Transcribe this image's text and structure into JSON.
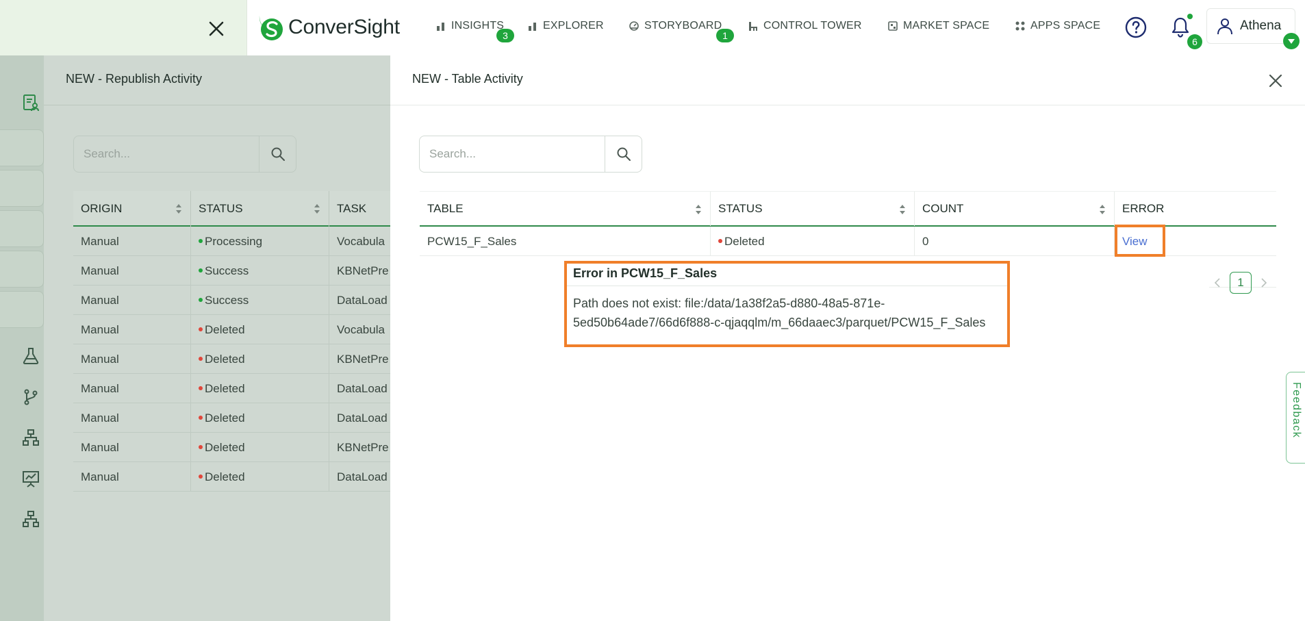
{
  "app": {
    "logo_text": "ConverSight",
    "brand_color": "#1fa53c"
  },
  "nav": {
    "items": [
      {
        "label": "INSIGHTS",
        "icon": "bar-chart-icon",
        "badge": "3"
      },
      {
        "label": "EXPLORER",
        "icon": "bar-chart-icon",
        "badge": ""
      },
      {
        "label": "STORYBOARD",
        "icon": "dashboard-gauge-icon",
        "badge": "1"
      },
      {
        "label": "CONTROL TOWER",
        "icon": "control-tower-icon",
        "badge": ""
      },
      {
        "label": "MARKET SPACE",
        "icon": "market-space-icon",
        "badge": ""
      },
      {
        "label": "APPS SPACE",
        "icon": "apps-grid-icon",
        "badge": ""
      }
    ],
    "notifications_count": "6",
    "user_name": "Athena"
  },
  "republish_panel": {
    "title": "NEW - Republish Activity",
    "search_placeholder": "Search...",
    "columns": [
      "ORIGIN",
      "STATUS",
      "TASK"
    ],
    "rows": [
      {
        "origin": "Manual",
        "status": "Processing",
        "status_color": "#1fa53c",
        "task": "Vocabula"
      },
      {
        "origin": "Manual",
        "status": "Success",
        "status_color": "#1fa53c",
        "task": "KBNetPre"
      },
      {
        "origin": "Manual",
        "status": "Success",
        "status_color": "#1fa53c",
        "task": "DataLoad"
      },
      {
        "origin": "Manual",
        "status": "Deleted",
        "status_color": "#e0463a",
        "task": "Vocabula"
      },
      {
        "origin": "Manual",
        "status": "Deleted",
        "status_color": "#e0463a",
        "task": "KBNetPre"
      },
      {
        "origin": "Manual",
        "status": "Deleted",
        "status_color": "#e0463a",
        "task": "DataLoad"
      },
      {
        "origin": "Manual",
        "status": "Deleted",
        "status_color": "#e0463a",
        "task": "DataLoad"
      },
      {
        "origin": "Manual",
        "status": "Deleted",
        "status_color": "#e0463a",
        "task": "KBNetPre"
      },
      {
        "origin": "Manual",
        "status": "Deleted",
        "status_color": "#e0463a",
        "task": "DataLoad"
      }
    ]
  },
  "table_panel": {
    "title": "NEW - Table Activity",
    "search_placeholder": "Search...",
    "columns": [
      "TABLE",
      "STATUS",
      "COUNT",
      "ERROR"
    ],
    "row": {
      "table": "PCW15_F_Sales",
      "status": "Deleted",
      "status_color": "#e0463a",
      "count": "0",
      "error_link": "View"
    },
    "error_popup": {
      "title": "Error in PCW15_F_Sales",
      "message": "Path does not exist: file:/data/1a38f2a5-d880-48a5-871e-5ed50b64ade7/66d6f888-c-qjaqqlm/m_66daaec3/parquet/PCW15_F_Sales"
    },
    "pagination": {
      "current_page": "1"
    }
  },
  "feedback_label": "Feedback",
  "highlight_color": "#f07f2a"
}
